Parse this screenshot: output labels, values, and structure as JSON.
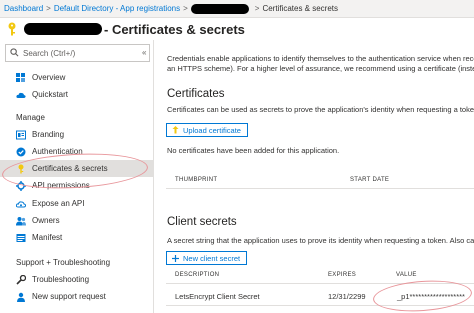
{
  "breadcrumb": {
    "items": [
      "Dashboard",
      "Default Directory - App registrations"
    ],
    "current": "Certificates & secrets"
  },
  "header": {
    "title": "- Certificates & secrets"
  },
  "sidebar": {
    "search_placeholder": "Search (Ctrl+/)",
    "collapse_glyph": "«",
    "items": [
      {
        "label": "Overview",
        "icon": "grid-icon"
      },
      {
        "label": "Quickstart",
        "icon": "cloud-icon"
      }
    ],
    "manage_header": "Manage",
    "manage_items": [
      {
        "label": "Branding",
        "icon": "branding-icon"
      },
      {
        "label": "Authentication",
        "icon": "authentication-icon"
      },
      {
        "label": "Certificates & secrets",
        "icon": "key-icon",
        "active": true
      },
      {
        "label": "API permissions",
        "icon": "api-permissions-icon"
      },
      {
        "label": "Expose an API",
        "icon": "cloud-api-icon"
      },
      {
        "label": "Owners",
        "icon": "owners-icon"
      },
      {
        "label": "Manifest",
        "icon": "manifest-icon"
      }
    ],
    "support_header": "Support + Troubleshooting",
    "support_items": [
      {
        "label": "Troubleshooting",
        "icon": "wrench-icon"
      },
      {
        "label": "New support request",
        "icon": "person-icon"
      }
    ]
  },
  "main": {
    "intro_line1": "Credentials enable applications to identify themselves to the authentication service when receivin",
    "intro_line2": "an HTTPS scheme). For a higher level of assurance, we recommend using a certificate (instead of",
    "certificates": {
      "heading": "Certificates",
      "description": "Certificates can be used as secrets to prove the application's identity when requesting a token. Al",
      "upload_label": "Upload certificate",
      "empty_message": "No certificates have been added for this application.",
      "columns": [
        "THUMBPRINT",
        "START DATE"
      ]
    },
    "client_secrets": {
      "heading": "Client secrets",
      "description": "A secret string that the application uses to prove its identity when requesting a token. Also can b",
      "new_label": "New client secret",
      "columns": [
        "DESCRIPTION",
        "EXPIRES",
        "VALUE"
      ],
      "rows": [
        {
          "description": "LetsEncrypt Client Secret",
          "expires": "12/31/2299",
          "value": "_p1*******************"
        }
      ]
    }
  },
  "colors": {
    "accent": "#0078d4",
    "highlight_circle": "#e8969b",
    "active_item": "#e1dfdd"
  }
}
